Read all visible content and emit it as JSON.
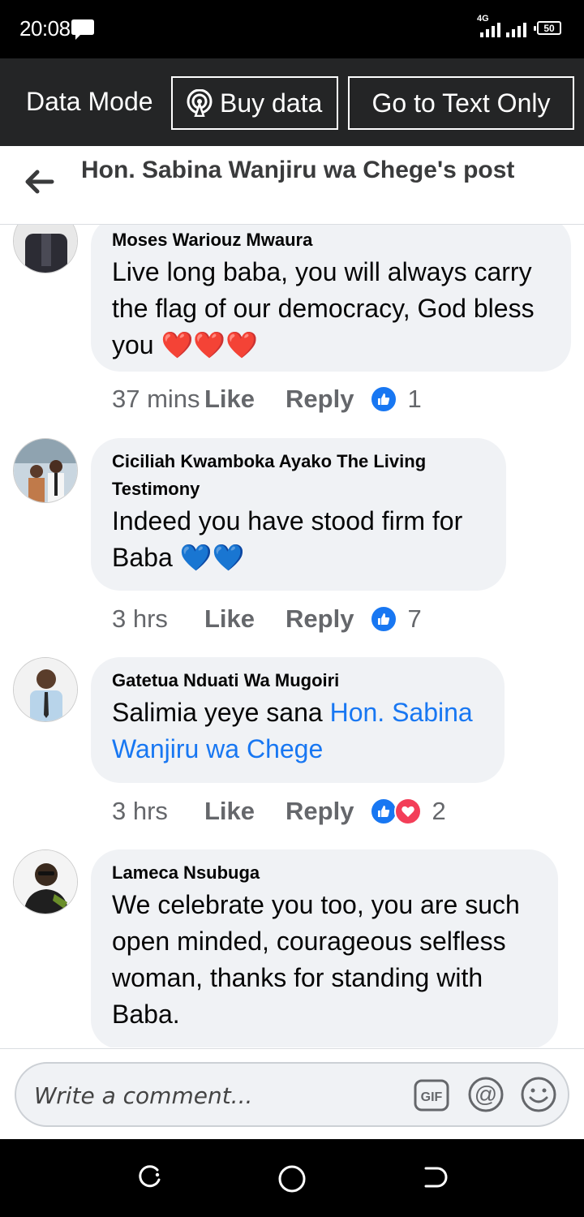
{
  "status_bar": {
    "time": "20:08",
    "network": "4G",
    "battery": "50"
  },
  "data_bar": {
    "mode_label": "Data Mode",
    "buy_data_label": "Buy data",
    "text_only_label": "Go to Text Only"
  },
  "header": {
    "title": "Hon. Sabina Wanjiru wa Chege's post"
  },
  "comments": [
    {
      "author": "Moses Wariouz Mwaura",
      "text": "Live long baba, you will always carry the flag of our democracy, God bless you ❤️❤️❤️",
      "time": "37 mins",
      "like_label": "Like",
      "reply_label": "Reply",
      "reactions": [
        "like"
      ],
      "reaction_count": "1"
    },
    {
      "author": "Ciciliah Kwamboka Ayako The Living Testimony",
      "text": "Indeed you have stood firm for Baba 💙💙",
      "time": "3 hrs",
      "like_label": "Like",
      "reply_label": "Reply",
      "reactions": [
        "like"
      ],
      "reaction_count": "7"
    },
    {
      "author": "Gatetua Nduati Wa Mugoiri",
      "text_before": "Salimia yeye sana ",
      "mention": "Hon. Sabina Wanjiru wa Chege",
      "time": "3 hrs",
      "like_label": "Like",
      "reply_label": "Reply",
      "reactions": [
        "like",
        "love"
      ],
      "reaction_count": "2"
    },
    {
      "author": "Lameca Nsubuga",
      "text": "We celebrate you too, you are such open minded, courageous selfless woman, thanks for standing with Baba."
    }
  ],
  "composer": {
    "placeholder": "Write a comment..."
  },
  "colors": {
    "accent_blue": "#1877f2",
    "love_red": "#f33e58",
    "bubble_gray": "#f0f2f5",
    "data_bar_bg": "#242526"
  }
}
